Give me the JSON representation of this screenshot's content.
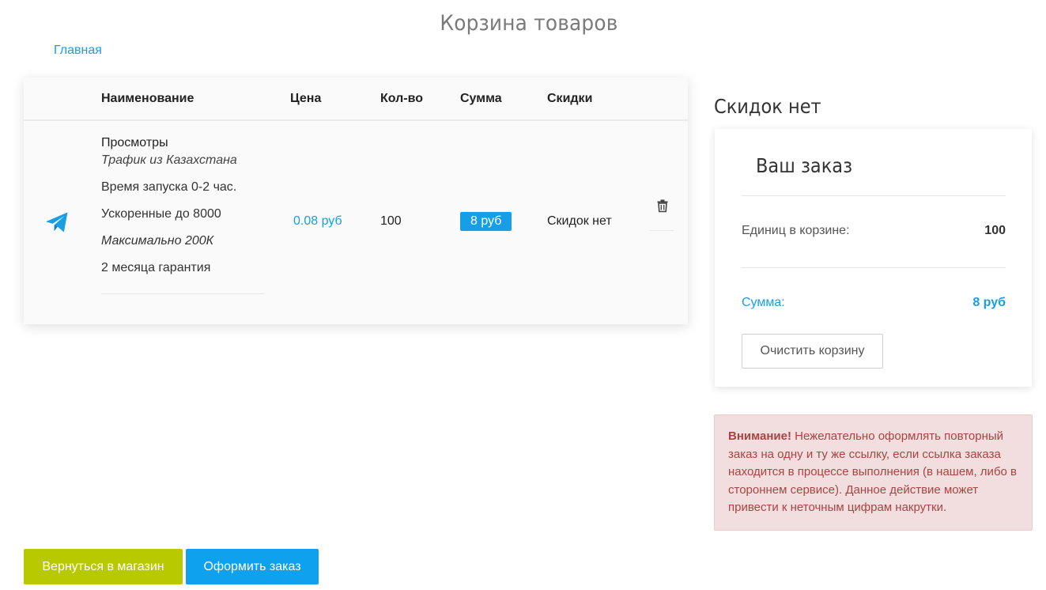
{
  "page": {
    "title": "Корзина товаров",
    "home_link": "Главная"
  },
  "table": {
    "headers": {
      "name": "Наименование",
      "price": "Цена",
      "qty": "Кол-во",
      "sum": "Сумма",
      "discounts": "Скидки"
    },
    "rows": [
      {
        "icon": "telegram-plane-icon",
        "title": "Просмотры",
        "subtitle": "Трафик из Казахстана",
        "lines": [
          "Время запуска 0-2 час.",
          "Ускоренные до 8000",
          "Максимально 200К",
          "2 месяца гарантия"
        ],
        "price": "0.08 руб",
        "qty": "100",
        "sum": "8 руб",
        "discount": "Скидок нет"
      }
    ]
  },
  "summary": {
    "discount_title": "Скидок нет",
    "order_title": "Ваш заказ",
    "units_label": "Единиц в корзине:",
    "units_value": "100",
    "sum_label": "Сумма:",
    "sum_value": "8 руб",
    "clear_button": "Очистить корзину"
  },
  "alert": {
    "strong": "Внимание!",
    "text": " Нежелательно оформлять повторный заказ на одну и ту же ссылку, если ссылка заказа находится в процессе выполнения (в нашем, либо в стороннем сервисе). Данное действие может привести к неточным цифрам накрутки."
  },
  "actions": {
    "back_button": "Вернуться в магазин",
    "checkout_button": "Оформить заказ"
  },
  "colors": {
    "accent": "#169fe6",
    "back_button": "#b8c900",
    "alert_bg": "#f2dede",
    "alert_text": "#a94442"
  }
}
